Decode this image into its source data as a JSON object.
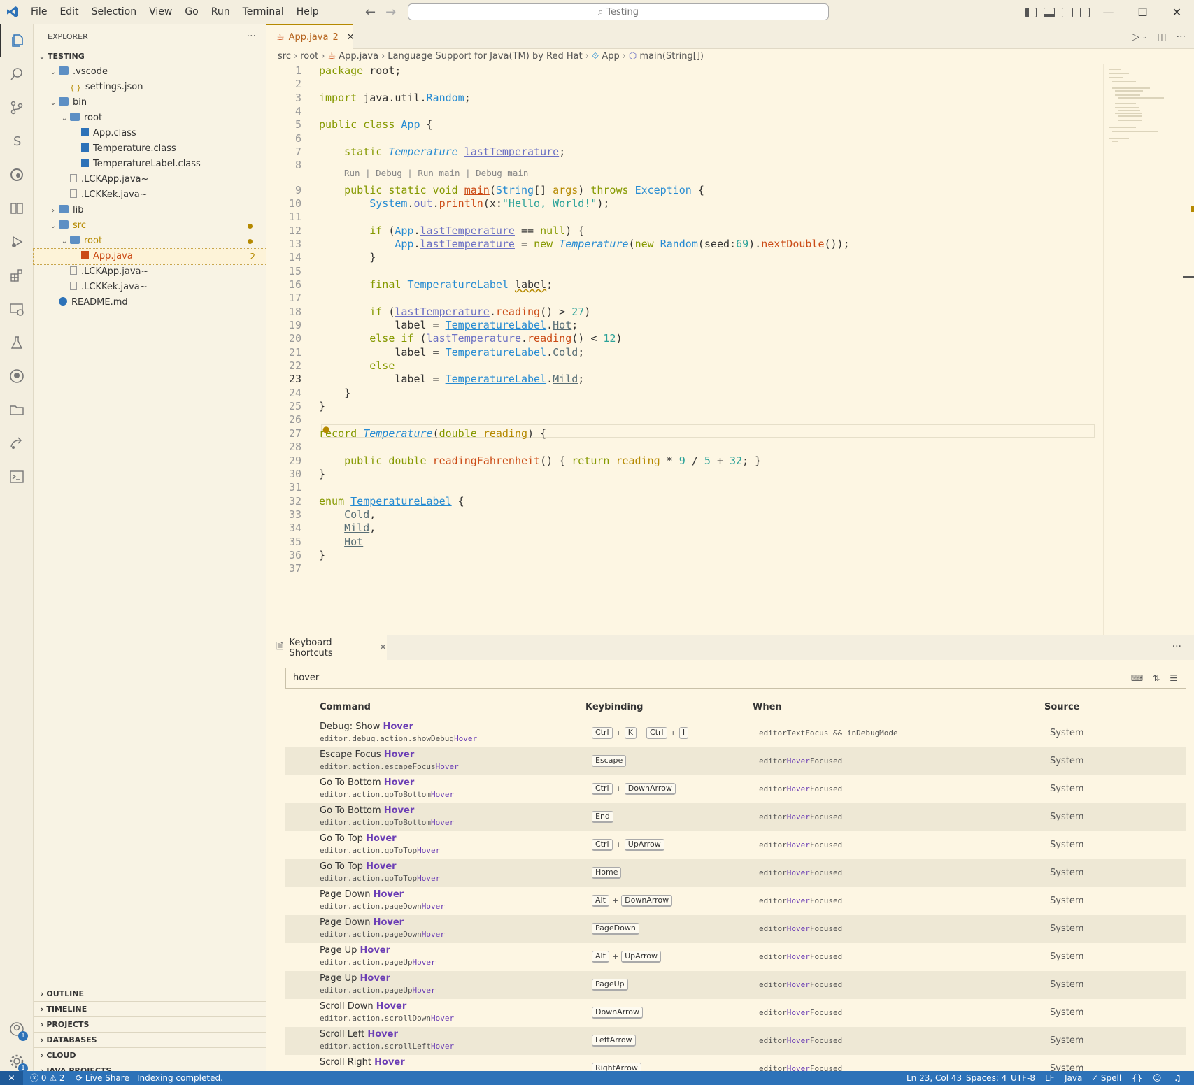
{
  "menu": [
    "File",
    "Edit",
    "Selection",
    "View",
    "Go",
    "Run",
    "Terminal",
    "Help"
  ],
  "search_box": "Testing",
  "explorer": {
    "title": "EXPLORER",
    "more": "···",
    "root": "TESTING",
    "items": [
      {
        "label": ".vscode",
        "depth": 1,
        "type": "folder",
        "open": true
      },
      {
        "label": "settings.json",
        "depth": 2,
        "type": "json"
      },
      {
        "label": "bin",
        "depth": 1,
        "type": "folder",
        "open": true
      },
      {
        "label": "root",
        "depth": 2,
        "type": "folder",
        "open": true
      },
      {
        "label": "App.class",
        "depth": 3,
        "type": "class"
      },
      {
        "label": "Temperature.class",
        "depth": 3,
        "type": "class"
      },
      {
        "label": "TemperatureLabel.class",
        "depth": 3,
        "type": "class"
      },
      {
        "label": ".LCKApp.java~",
        "depth": 2,
        "type": "file"
      },
      {
        "label": ".LCKKek.java~",
        "depth": 2,
        "type": "file"
      },
      {
        "label": "lib",
        "depth": 1,
        "type": "folder",
        "open": false
      },
      {
        "label": "src",
        "depth": 1,
        "type": "folder",
        "open": true,
        "modified": true
      },
      {
        "label": "root",
        "depth": 2,
        "type": "folder",
        "open": true,
        "modified": true
      },
      {
        "label": "App.java",
        "depth": 3,
        "type": "java",
        "selected": true,
        "count": "2"
      },
      {
        "label": ".LCKApp.java~",
        "depth": 2,
        "type": "file"
      },
      {
        "label": ".LCKKek.java~",
        "depth": 2,
        "type": "file"
      },
      {
        "label": "README.md",
        "depth": 1,
        "type": "info"
      }
    ],
    "sections": [
      "OUTLINE",
      "TIMELINE",
      "PROJECTS",
      "DATABASES",
      "CLOUD",
      "JAVA PROJECTS"
    ]
  },
  "editor": {
    "tab_label": "App.java",
    "tab_count": "2",
    "breadcrumbs": [
      "src",
      "root",
      "App.java",
      "Language Support for Java(TM) by Red Hat",
      "App",
      "main(String[])"
    ],
    "code_lens": "Run | Debug | Run main | Debug main",
    "current_line": 23
  },
  "shortcuts": {
    "tab_label": "Keyboard Shortcuts",
    "search_value": "hover",
    "columns": {
      "command": "Command",
      "keybinding": "Keybinding",
      "when": "When",
      "source": "Source"
    },
    "rows": [
      {
        "pre": "Debug: Show ",
        "hl": "Hover",
        "id_pre": "editor.debug.action.showDebug",
        "id_hl": "Hover",
        "keys": [
          [
            "Ctrl",
            "K"
          ],
          [
            "Ctrl",
            "I"
          ]
        ],
        "when_pre": "editorTextFocus && inDebugMode",
        "when_hl": "",
        "when_post": "",
        "source": "System"
      },
      {
        "pre": "Escape Focus ",
        "hl": "Hover",
        "id_pre": "editor.action.escapeFocus",
        "id_hl": "Hover",
        "keys": [
          [
            "Escape"
          ]
        ],
        "when_pre": "editor",
        "when_hl": "Hover",
        "when_post": "Focused",
        "source": "System"
      },
      {
        "pre": "Go To Bottom ",
        "hl": "Hover",
        "id_pre": "editor.action.goToBottom",
        "id_hl": "Hover",
        "keys": [
          [
            "Ctrl",
            "DownArrow"
          ]
        ],
        "when_pre": "editor",
        "when_hl": "Hover",
        "when_post": "Focused",
        "source": "System"
      },
      {
        "pre": "Go To Bottom ",
        "hl": "Hover",
        "id_pre": "editor.action.goToBottom",
        "id_hl": "Hover",
        "keys": [
          [
            "End"
          ]
        ],
        "when_pre": "editor",
        "when_hl": "Hover",
        "when_post": "Focused",
        "source": "System"
      },
      {
        "pre": "Go To Top ",
        "hl": "Hover",
        "id_pre": "editor.action.goToTop",
        "id_hl": "Hover",
        "keys": [
          [
            "Ctrl",
            "UpArrow"
          ]
        ],
        "when_pre": "editor",
        "when_hl": "Hover",
        "when_post": "Focused",
        "source": "System"
      },
      {
        "pre": "Go To Top ",
        "hl": "Hover",
        "id_pre": "editor.action.goToTop",
        "id_hl": "Hover",
        "keys": [
          [
            "Home"
          ]
        ],
        "when_pre": "editor",
        "when_hl": "Hover",
        "when_post": "Focused",
        "source": "System"
      },
      {
        "pre": "Page Down ",
        "hl": "Hover",
        "id_pre": "editor.action.pageDown",
        "id_hl": "Hover",
        "keys": [
          [
            "Alt",
            "DownArrow"
          ]
        ],
        "when_pre": "editor",
        "when_hl": "Hover",
        "when_post": "Focused",
        "source": "System"
      },
      {
        "pre": "Page Down ",
        "hl": "Hover",
        "id_pre": "editor.action.pageDown",
        "id_hl": "Hover",
        "keys": [
          [
            "PageDown"
          ]
        ],
        "when_pre": "editor",
        "when_hl": "Hover",
        "when_post": "Focused",
        "source": "System"
      },
      {
        "pre": "Page Up ",
        "hl": "Hover",
        "id_pre": "editor.action.pageUp",
        "id_hl": "Hover",
        "keys": [
          [
            "Alt",
            "UpArrow"
          ]
        ],
        "when_pre": "editor",
        "when_hl": "Hover",
        "when_post": "Focused",
        "source": "System"
      },
      {
        "pre": "Page Up ",
        "hl": "Hover",
        "id_pre": "editor.action.pageUp",
        "id_hl": "Hover",
        "keys": [
          [
            "PageUp"
          ]
        ],
        "when_pre": "editor",
        "when_hl": "Hover",
        "when_post": "Focused",
        "source": "System"
      },
      {
        "pre": "Scroll Down ",
        "hl": "Hover",
        "id_pre": "editor.action.scrollDown",
        "id_hl": "Hover",
        "keys": [
          [
            "DownArrow"
          ]
        ],
        "when_pre": "editor",
        "when_hl": "Hover",
        "when_post": "Focused",
        "source": "System"
      },
      {
        "pre": "Scroll Left ",
        "hl": "Hover",
        "id_pre": "editor.action.scrollLeft",
        "id_hl": "Hover",
        "keys": [
          [
            "LeftArrow"
          ]
        ],
        "when_pre": "editor",
        "when_hl": "Hover",
        "when_post": "Focused",
        "source": "System"
      },
      {
        "pre": "Scroll Right ",
        "hl": "Hover",
        "id_pre": "editor.action.scrollRight",
        "id_hl": "Hover",
        "keys": [
          [
            "RightArrow"
          ]
        ],
        "when_pre": "editor",
        "when_hl": "Hover",
        "when_post": "Focused",
        "source": "System"
      }
    ]
  },
  "status": {
    "errors": "0",
    "warnings": "2",
    "live_share": "Live Share",
    "message": "Indexing completed.",
    "position": "Ln 23, Col 43",
    "spaces": "Spaces: 4",
    "encoding": "UTF-8",
    "eol": "LF",
    "language": "Java",
    "spell": "Spell"
  },
  "activity_badges": {
    "accounts": "1",
    "settings": "1"
  }
}
